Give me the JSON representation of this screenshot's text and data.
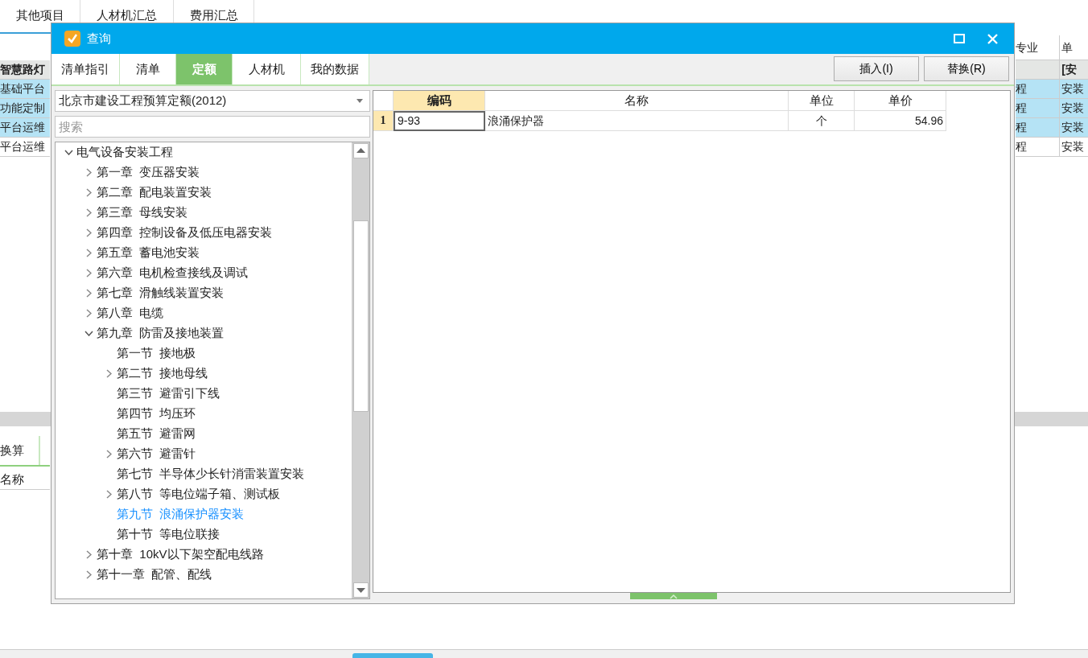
{
  "background": {
    "tabs": [
      "其他项目",
      "人材机汇总",
      "费用汇总"
    ],
    "left_rows": [
      {
        "text": "智慧路灯",
        "kind": "header",
        "highlighted": false
      },
      {
        "text": "基础平台",
        "kind": "row",
        "highlighted": true
      },
      {
        "text": "功能定制",
        "kind": "row",
        "highlighted": true
      },
      {
        "text": "平台运维",
        "kind": "row",
        "highlighted": true
      },
      {
        "text": "平台运维",
        "kind": "row",
        "highlighted": false
      }
    ],
    "right_header": [
      "专业",
      "单"
    ],
    "right_rows": [
      {
        "cells": [
          "",
          "[安"
        ],
        "kind": "header",
        "highlighted": false
      },
      {
        "cells": [
          "程",
          "安装"
        ],
        "kind": "row",
        "highlighted": true
      },
      {
        "cells": [
          "程",
          "安装"
        ],
        "kind": "row",
        "highlighted": true
      },
      {
        "cells": [
          "程",
          "安装"
        ],
        "kind": "row",
        "highlighted": true
      },
      {
        "cells": [
          "程",
          "安装"
        ],
        "kind": "row",
        "highlighted": false
      }
    ],
    "lower_tab": "换算",
    "lower_rows": [
      "名称"
    ]
  },
  "dialog": {
    "title": "查询",
    "tabs": [
      {
        "label": "清单指引",
        "selected": false
      },
      {
        "label": "清单",
        "selected": false
      },
      {
        "label": "定额",
        "selected": true
      },
      {
        "label": "人材机",
        "selected": false
      },
      {
        "label": "我的数据",
        "selected": false
      }
    ],
    "buttons": [
      "插入(I)",
      "替换(R)"
    ],
    "library": "北京市建设工程预算定额(2012)",
    "search": {
      "placeholder": "搜索"
    },
    "tree": [
      {
        "label": "电气设备安装工程",
        "kind": "branch",
        "expanded": true,
        "selected": false,
        "children": [
          {
            "label": "第一章  变压器安装",
            "kind": "branch",
            "expanded": false,
            "selected": false
          },
          {
            "label": "第二章  配电装置安装",
            "kind": "branch",
            "expanded": false,
            "selected": false
          },
          {
            "label": "第三章  母线安装",
            "kind": "branch",
            "expanded": false,
            "selected": false
          },
          {
            "label": "第四章  控制设备及低压电器安装",
            "kind": "branch",
            "expanded": false,
            "selected": false
          },
          {
            "label": "第五章  蓄电池安装",
            "kind": "branch",
            "expanded": false,
            "selected": false
          },
          {
            "label": "第六章  电机检查接线及调试",
            "kind": "branch",
            "expanded": false,
            "selected": false
          },
          {
            "label": "第七章  滑触线装置安装",
            "kind": "branch",
            "expanded": false,
            "selected": false
          },
          {
            "label": "第八章  电缆",
            "kind": "branch",
            "expanded": false,
            "selected": false
          },
          {
            "label": "第九章  防雷及接地装置",
            "kind": "branch",
            "expanded": true,
            "selected": false,
            "children": [
              {
                "label": "第一节  接地极",
                "kind": "leaf",
                "selected": false
              },
              {
                "label": "第二节  接地母线",
                "kind": "branch",
                "expanded": false,
                "selected": false
              },
              {
                "label": "第三节  避雷引下线",
                "kind": "leaf",
                "selected": false
              },
              {
                "label": "第四节  均压环",
                "kind": "leaf",
                "selected": false
              },
              {
                "label": "第五节  避雷网",
                "kind": "leaf",
                "selected": false
              },
              {
                "label": "第六节  避雷针",
                "kind": "branch",
                "expanded": false,
                "selected": false
              },
              {
                "label": "第七节  半导体少长针消雷装置安装",
                "kind": "leaf",
                "selected": false
              },
              {
                "label": "第八节  等电位端子箱、测试板",
                "kind": "branch",
                "expanded": false,
                "selected": false
              },
              {
                "label": "第九节  浪涌保护器安装",
                "kind": "leaf",
                "selected": true
              },
              {
                "label": "第十节  等电位联接",
                "kind": "leaf",
                "selected": false
              }
            ]
          },
          {
            "label": "第十章  10kV以下架空配电线路",
            "kind": "branch",
            "expanded": false,
            "selected": false
          },
          {
            "label": "第十一章  配管、配线",
            "kind": "branch",
            "expanded": false,
            "selected": false
          }
        ]
      }
    ],
    "table": {
      "columns": [
        {
          "label": "编码",
          "active": true
        },
        {
          "label": "名称",
          "active": false
        },
        {
          "label": "单位",
          "active": false
        },
        {
          "label": "单价",
          "active": false
        }
      ],
      "rows": [
        {
          "index": "1",
          "selected": true,
          "cells": [
            "9-93",
            "浪涌保护器",
            "个",
            "54.96"
          ]
        }
      ]
    }
  }
}
